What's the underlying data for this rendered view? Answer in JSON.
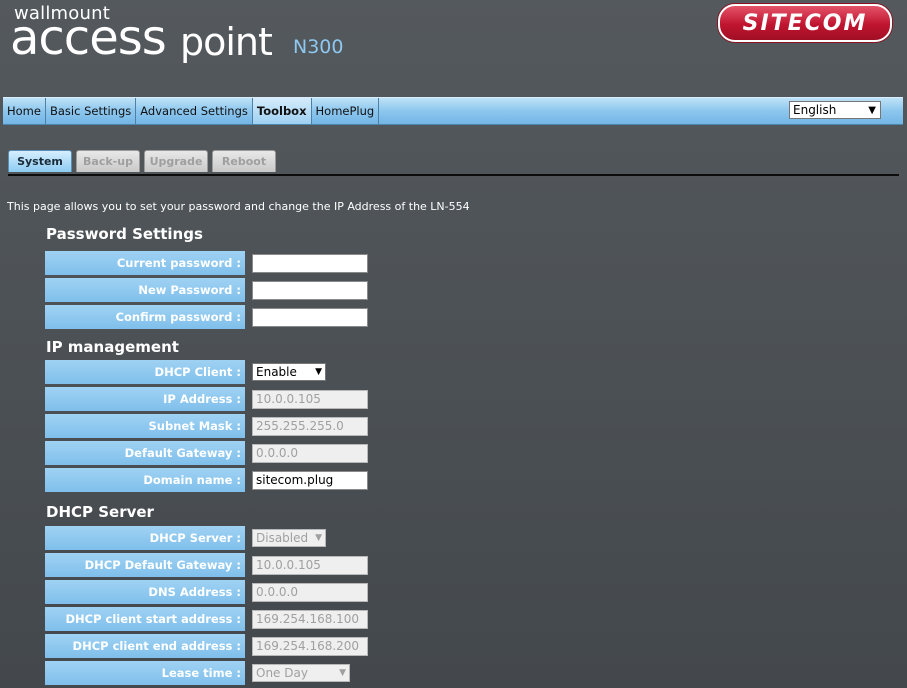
{
  "header": {
    "brand_small": "wallmount",
    "brand_access": "access",
    "brand_point": "point",
    "brand_model": "N300",
    "logo_text": "SITECOM"
  },
  "nav": {
    "items": [
      "Home",
      "Basic Settings",
      "Advanced Settings",
      "Toolbox",
      "HomePlug"
    ],
    "active": "Toolbox",
    "language": "English",
    "language_icon": "chevron-down-icon"
  },
  "tabs": {
    "items": [
      "System",
      "Back-up",
      "Upgrade",
      "Reboot"
    ],
    "active": "System"
  },
  "intro": "This page allows you to set your password and change the IP Address of the LN-554",
  "password_section": {
    "title": "Password Settings",
    "current_label": "Current password :",
    "new_label": "New Password :",
    "confirm_label": "Confirm password :",
    "current_value": "",
    "new_value": "",
    "confirm_value": ""
  },
  "ip_section": {
    "title": "IP management",
    "dhcp_client_label": "DHCP Client :",
    "dhcp_client_value": "Enable",
    "ip_label": "IP Address :",
    "ip_value": "10.0.0.105",
    "mask_label": "Subnet Mask :",
    "mask_value": "255.255.255.0",
    "gateway_label": "Default Gateway :",
    "gateway_value": "0.0.0.0",
    "domain_label": "Domain name :",
    "domain_value": "sitecom.plug"
  },
  "dhcp_section": {
    "title": "DHCP Server",
    "server_label": "DHCP Server :",
    "server_value": "Disabled",
    "gateway_label": "DHCP Default Gateway :",
    "gateway_value": "10.0.0.105",
    "dns_label": "DNS Address :",
    "dns_value": "0.0.0.0",
    "start_label": "DHCP client start address :",
    "start_value": "169.254.168.100",
    "end_label": "DHCP client end address :",
    "end_value": "169.254.168.200",
    "lease_label": "Lease time :",
    "lease_value": "One Day"
  },
  "colors": {
    "background": "#4e5357",
    "label_bg": "#8cc6ee",
    "nav_bg": "#8cc6ee",
    "logo_red": "#c0142f",
    "model_blue": "#8ec8f0"
  }
}
